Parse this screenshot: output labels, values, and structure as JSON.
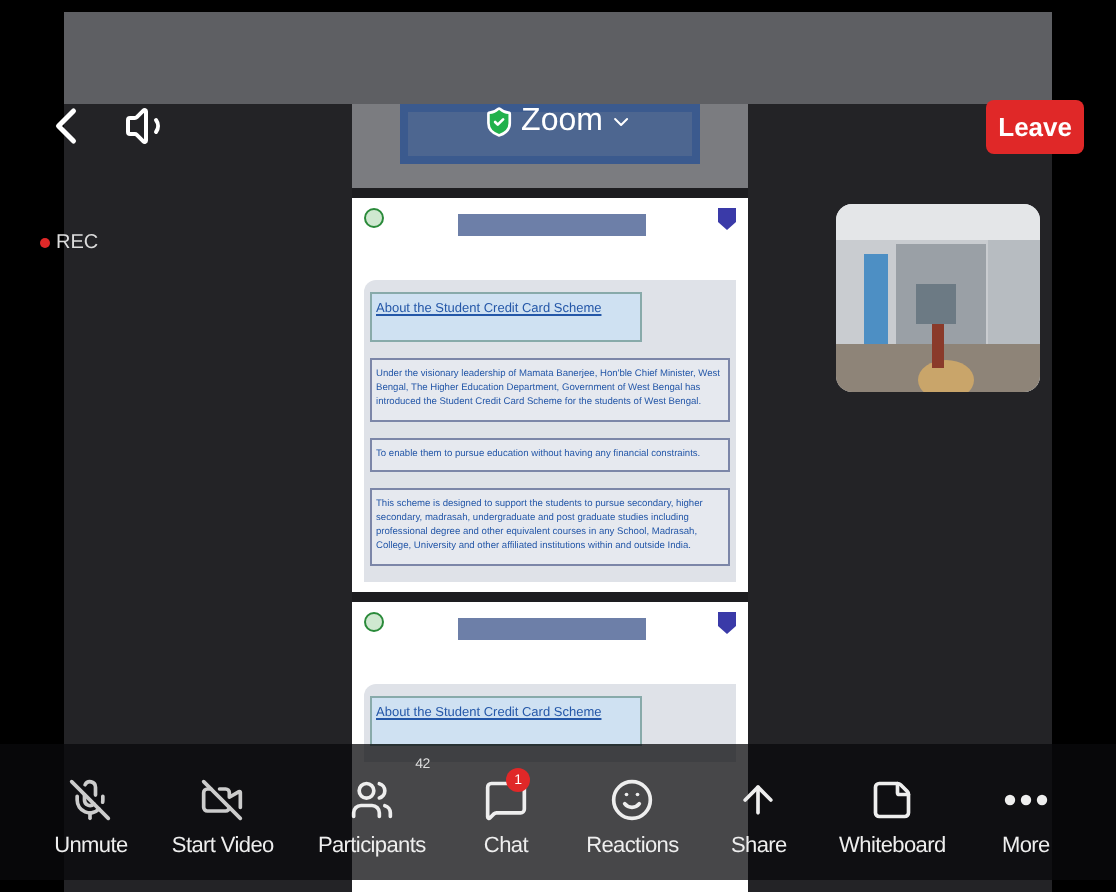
{
  "top_bar": {
    "title": "Zoom",
    "leave": "Leave"
  },
  "recording": {
    "label": "REC",
    "on": true
  },
  "pages": [
    {
      "heading": "About the Student Credit Card Scheme",
      "paragraphs": [
        "Under the visionary leadership of Mamata Banerjee, Hon'ble Chief Minister, West Bengal, The Higher Education Department, Government of West Bengal has introduced the Student Credit Card Scheme for the students of West Bengal.",
        "To enable them to pursue education without having any financial constraints.",
        "This scheme is designed to support the students to pursue secondary, higher secondary, madrasah, undergraduate and post graduate studies including professional degree and other equivalent courses in any School, Madrasah, College, University and other affiliated institutions within and outside India."
      ]
    },
    {
      "heading": "About the Student Credit Card Scheme"
    }
  ],
  "toolbar": [
    {
      "kind": "mic",
      "label": "Unmute",
      "off": true
    },
    {
      "kind": "video",
      "label": "Start Video",
      "off": true
    },
    {
      "kind": "participants",
      "label": "Participants",
      "count": "42"
    },
    {
      "kind": "chat",
      "label": "Chat",
      "badge": "1"
    },
    {
      "kind": "reactions",
      "label": "Reactions"
    },
    {
      "kind": "share",
      "label": "Share"
    },
    {
      "kind": "whiteboard",
      "label": "Whiteboard"
    },
    {
      "kind": "more",
      "label": "More"
    }
  ]
}
